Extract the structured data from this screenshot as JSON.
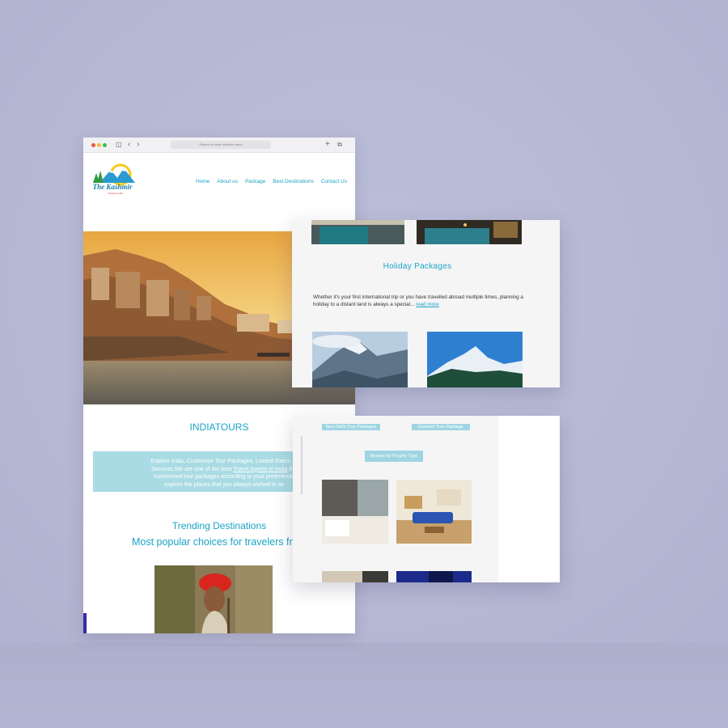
{
  "browser": {
    "address_placeholder": "Search or enter website name",
    "icons": [
      "sidebar-icon",
      "back-icon",
      "forward-icon",
      "new-tab-icon",
      "tabs-icon"
    ]
  },
  "site": {
    "logo_title": "The Kashmir",
    "logo_sub": "Travelers Hills",
    "nav": [
      "Home",
      "About us",
      "Package",
      "Best Destinations",
      "Contact Us"
    ],
    "section_title": "INDIATOURS",
    "info_line1": "Explore India, Customize Tour Packages, Lowest Rates, G",
    "info_line2_prefix": "Services.We are one of the best ",
    "info_line2_link": "Travel Agents in India",
    "info_line2_suffix": " the",
    "info_line3": "customised tour packages according to your preference,",
    "info_line4": "explore the places that you always wished to se",
    "trending_title": "Trending Destinations",
    "trending_subtitle": "Most popular choices for travelers from"
  },
  "holiday": {
    "title": "Holiday  Packages",
    "text": "Whether it's your first international trip or you have travelled abroad multiple times, planning a holiday to a distant land is always a special...",
    "read_more": "read more"
  },
  "tours": {
    "tag1": "New Delhi Tour Packages",
    "tag2": "Kashmir Tour Package",
    "browse_button": "Browse by Proprty Type"
  },
  "colors": {
    "background": "#b5b7d3",
    "accent": "#1aa4c6",
    "info_box": "#a9dbe4",
    "tag": "#9fd5e2"
  }
}
